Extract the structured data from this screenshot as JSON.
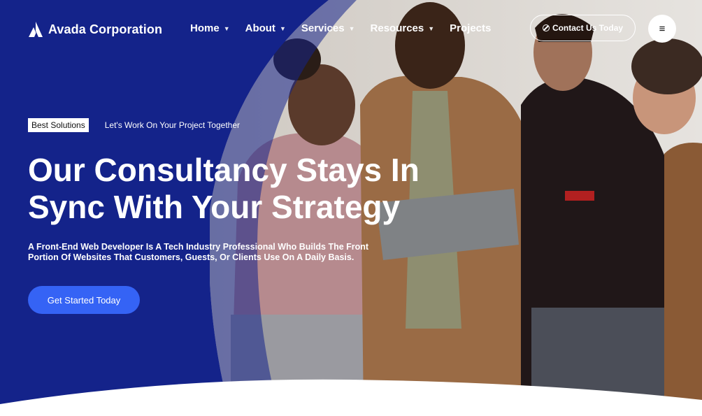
{
  "brand": {
    "name": "Avada Corporation",
    "logo_icon": "avada-a-logo-icon"
  },
  "nav": {
    "items": [
      {
        "label": "Home",
        "has_dropdown": true
      },
      {
        "label": "About",
        "has_dropdown": true
      },
      {
        "label": "Services",
        "has_dropdown": true
      },
      {
        "label": "Resources",
        "has_dropdown": true
      },
      {
        "label": "Projects",
        "has_dropdown": false
      }
    ],
    "dropdown_icon": "chevron-down-icon"
  },
  "header": {
    "contact_label": "Contact Us Today",
    "contact_icon": "ban-icon",
    "menu_icon": "hamburger-menu-icon",
    "menu_glyph": "≡"
  },
  "hero": {
    "badge": "Best Solutions",
    "tagline": "Let's Work On Your Project Together",
    "headline_line1": "Our Consultancy Stays In",
    "headline_line2": "Sync With Your Strategy",
    "description": "A Front-End Web Developer Is A Tech Industry Professional Who Builds The Front Portion Of Websites That Customers, Guests, Or Clients Use On A Daily Basis.",
    "cta_label": "Get Started Today",
    "image_subject": "four colleagues looking at a laptop"
  },
  "colors": {
    "primary_navy": "#14238a",
    "accent_blue": "#3563f5",
    "white": "#ffffff"
  }
}
